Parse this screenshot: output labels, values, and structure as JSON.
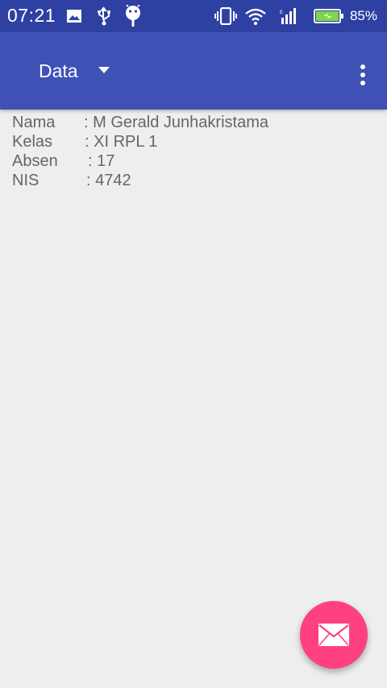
{
  "status_bar": {
    "time": "07:21",
    "battery_percent": "85%",
    "icons": [
      "image-icon",
      "usb-icon",
      "android-icon",
      "vibrate-icon",
      "wifi-icon",
      "signal-icon",
      "battery-charging-icon"
    ]
  },
  "toolbar": {
    "spinner_label": "Data",
    "color": "#3f51b5"
  },
  "student": {
    "rows": [
      {
        "label": "Nama",
        "value": ": M Gerald Junhakristama"
      },
      {
        "label": "Kelas",
        "value": ": XI RPL 1"
      },
      {
        "label": "Absen",
        "value": ": 17"
      },
      {
        "label": "NIS",
        "value": ": 4742"
      }
    ]
  },
  "fab": {
    "icon": "email-icon",
    "color": "#ff4081"
  }
}
